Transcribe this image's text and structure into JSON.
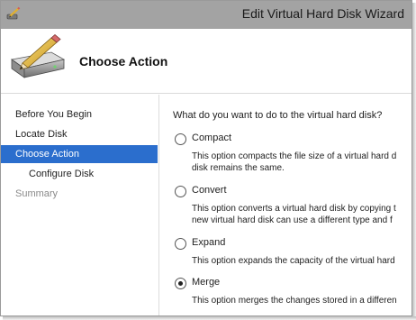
{
  "window": {
    "title": "Edit Virtual Hard Disk Wizard",
    "icon": "pencil-disk-icon"
  },
  "header": {
    "title": "Choose Action",
    "icon": "disk-with-pencil-icon"
  },
  "sidebar": {
    "items": [
      {
        "label": "Before You Begin",
        "state": "normal"
      },
      {
        "label": "Locate Disk",
        "state": "normal"
      },
      {
        "label": "Choose Action",
        "state": "selected"
      },
      {
        "label": "Configure Disk",
        "state": "normal"
      },
      {
        "label": "Summary",
        "state": "disabled"
      }
    ]
  },
  "main": {
    "question": "What do you want to do to the virtual hard disk?",
    "options": [
      {
        "label": "Compact",
        "selected": false,
        "desc": [
          "This option compacts the file size of a virtual hard d",
          "disk remains the same."
        ]
      },
      {
        "label": "Convert",
        "selected": false,
        "desc": [
          "This option converts a virtual hard disk by copying t",
          "new virtual hard disk can use a different type and f"
        ]
      },
      {
        "label": "Expand",
        "selected": false,
        "desc": [
          "This option expands the capacity of the virtual hard"
        ]
      },
      {
        "label": "Merge",
        "selected": true,
        "desc": [
          "This option merges the changes stored in a differen"
        ]
      }
    ]
  },
  "colors": {
    "selection": "#2b6ecd",
    "titlebar": "#a3a3a3"
  }
}
